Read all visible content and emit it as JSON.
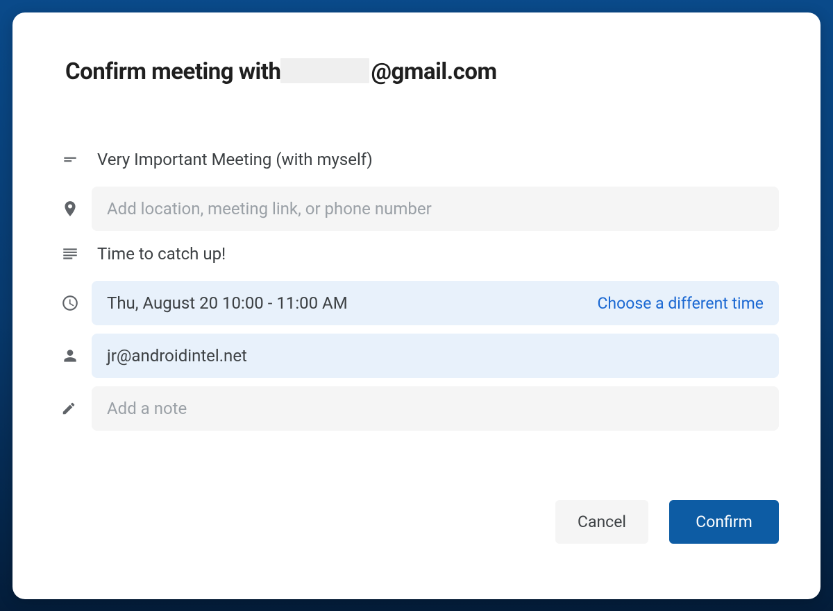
{
  "header": {
    "prefix": "Confirm meeting with",
    "redacted": true,
    "suffix": "@gmail.com"
  },
  "fields": {
    "title_value": "Very Important Meeting (with myself)",
    "location_placeholder": "Add location, meeting link, or phone number",
    "description_value": "Time to catch up!",
    "time_value": "Thu, August 20 10:00 - 11:00 AM",
    "time_change_link": "Choose a different time",
    "attendee_value": "jr@androidintel.net",
    "note_placeholder": "Add a note"
  },
  "buttons": {
    "cancel": "Cancel",
    "confirm": "Confirm"
  }
}
